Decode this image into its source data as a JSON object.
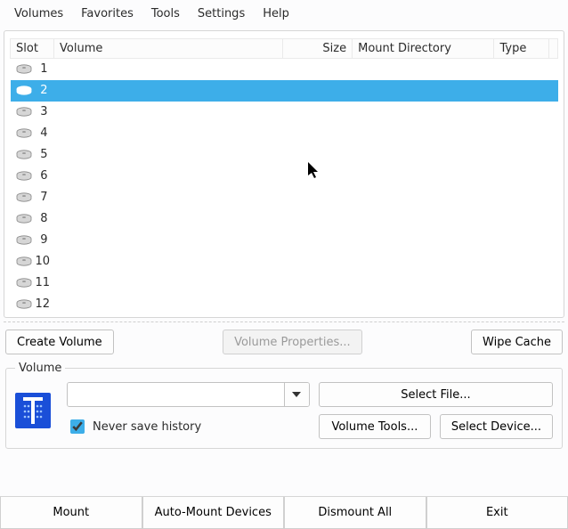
{
  "menu": {
    "items": [
      {
        "label": "Volumes"
      },
      {
        "label": "Favorites"
      },
      {
        "label": "Tools"
      },
      {
        "label": "Settings"
      },
      {
        "label": "Help"
      }
    ]
  },
  "table": {
    "headers": {
      "slot": "Slot",
      "volume": "Volume",
      "size": "Size",
      "mount": "Mount Directory",
      "type": "Type"
    },
    "rows": [
      {
        "slot": "1",
        "volume": "",
        "size": "",
        "mount": "",
        "type": "",
        "selected": false
      },
      {
        "slot": "2",
        "volume": "",
        "size": "",
        "mount": "",
        "type": "",
        "selected": true
      },
      {
        "slot": "3",
        "volume": "",
        "size": "",
        "mount": "",
        "type": "",
        "selected": false
      },
      {
        "slot": "4",
        "volume": "",
        "size": "",
        "mount": "",
        "type": "",
        "selected": false
      },
      {
        "slot": "5",
        "volume": "",
        "size": "",
        "mount": "",
        "type": "",
        "selected": false
      },
      {
        "slot": "6",
        "volume": "",
        "size": "",
        "mount": "",
        "type": "",
        "selected": false
      },
      {
        "slot": "7",
        "volume": "",
        "size": "",
        "mount": "",
        "type": "",
        "selected": false
      },
      {
        "slot": "8",
        "volume": "",
        "size": "",
        "mount": "",
        "type": "",
        "selected": false
      },
      {
        "slot": "9",
        "volume": "",
        "size": "",
        "mount": "",
        "type": "",
        "selected": false
      },
      {
        "slot": "10",
        "volume": "",
        "size": "",
        "mount": "",
        "type": "",
        "selected": false
      },
      {
        "slot": "11",
        "volume": "",
        "size": "",
        "mount": "",
        "type": "",
        "selected": false
      },
      {
        "slot": "12",
        "volume": "",
        "size": "",
        "mount": "",
        "type": "",
        "selected": false
      }
    ]
  },
  "actions": {
    "create": "Create Volume",
    "properties": "Volume Properties...",
    "wipe": "Wipe Cache"
  },
  "volume_group": {
    "legend": "Volume",
    "path_value": "",
    "select_file": "Select File...",
    "never_save": "Never save history",
    "volume_tools": "Volume Tools...",
    "select_device": "Select Device..."
  },
  "footer": {
    "mount": "Mount",
    "auto_mount": "Auto-Mount Devices",
    "dismount_all": "Dismount All",
    "exit": "Exit"
  }
}
